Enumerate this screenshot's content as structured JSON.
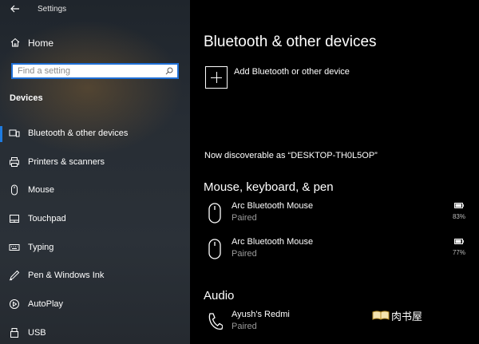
{
  "app": {
    "title": "Settings"
  },
  "sidebar": {
    "home_label": "Home",
    "search_placeholder": "Find a setting",
    "section_header": "Devices",
    "items": [
      {
        "label": "Bluetooth & other devices",
        "icon": "bluetooth-devices-icon",
        "active": true
      },
      {
        "label": "Printers & scanners",
        "icon": "printer-icon"
      },
      {
        "label": "Mouse",
        "icon": "mouse-icon"
      },
      {
        "label": "Touchpad",
        "icon": "touchpad-icon"
      },
      {
        "label": "Typing",
        "icon": "keyboard-icon"
      },
      {
        "label": "Pen & Windows Ink",
        "icon": "pen-icon"
      },
      {
        "label": "AutoPlay",
        "icon": "autoplay-icon"
      },
      {
        "label": "USB",
        "icon": "usb-icon"
      }
    ]
  },
  "main": {
    "title": "Bluetooth & other devices",
    "add_device_label": "Add Bluetooth or other device",
    "discoverable_text": "Now discoverable as “DESKTOP-TH0L5OP”",
    "sections": {
      "input": {
        "title": "Mouse, keyboard, & pen",
        "devices": [
          {
            "name": "Arc Bluetooth Mouse",
            "status": "Paired",
            "battery": "83%"
          },
          {
            "name": "Arc Bluetooth Mouse",
            "status": "Paired",
            "battery": "77%"
          }
        ]
      },
      "audio": {
        "title": "Audio",
        "devices": [
          {
            "name": "Ayush's Redmi",
            "status": "Paired"
          }
        ]
      }
    }
  },
  "watermark": {
    "text": "肉书屋"
  },
  "colors": {
    "accent": "#1e7be0",
    "background": "#000000",
    "sidebar": "#2a3036"
  }
}
